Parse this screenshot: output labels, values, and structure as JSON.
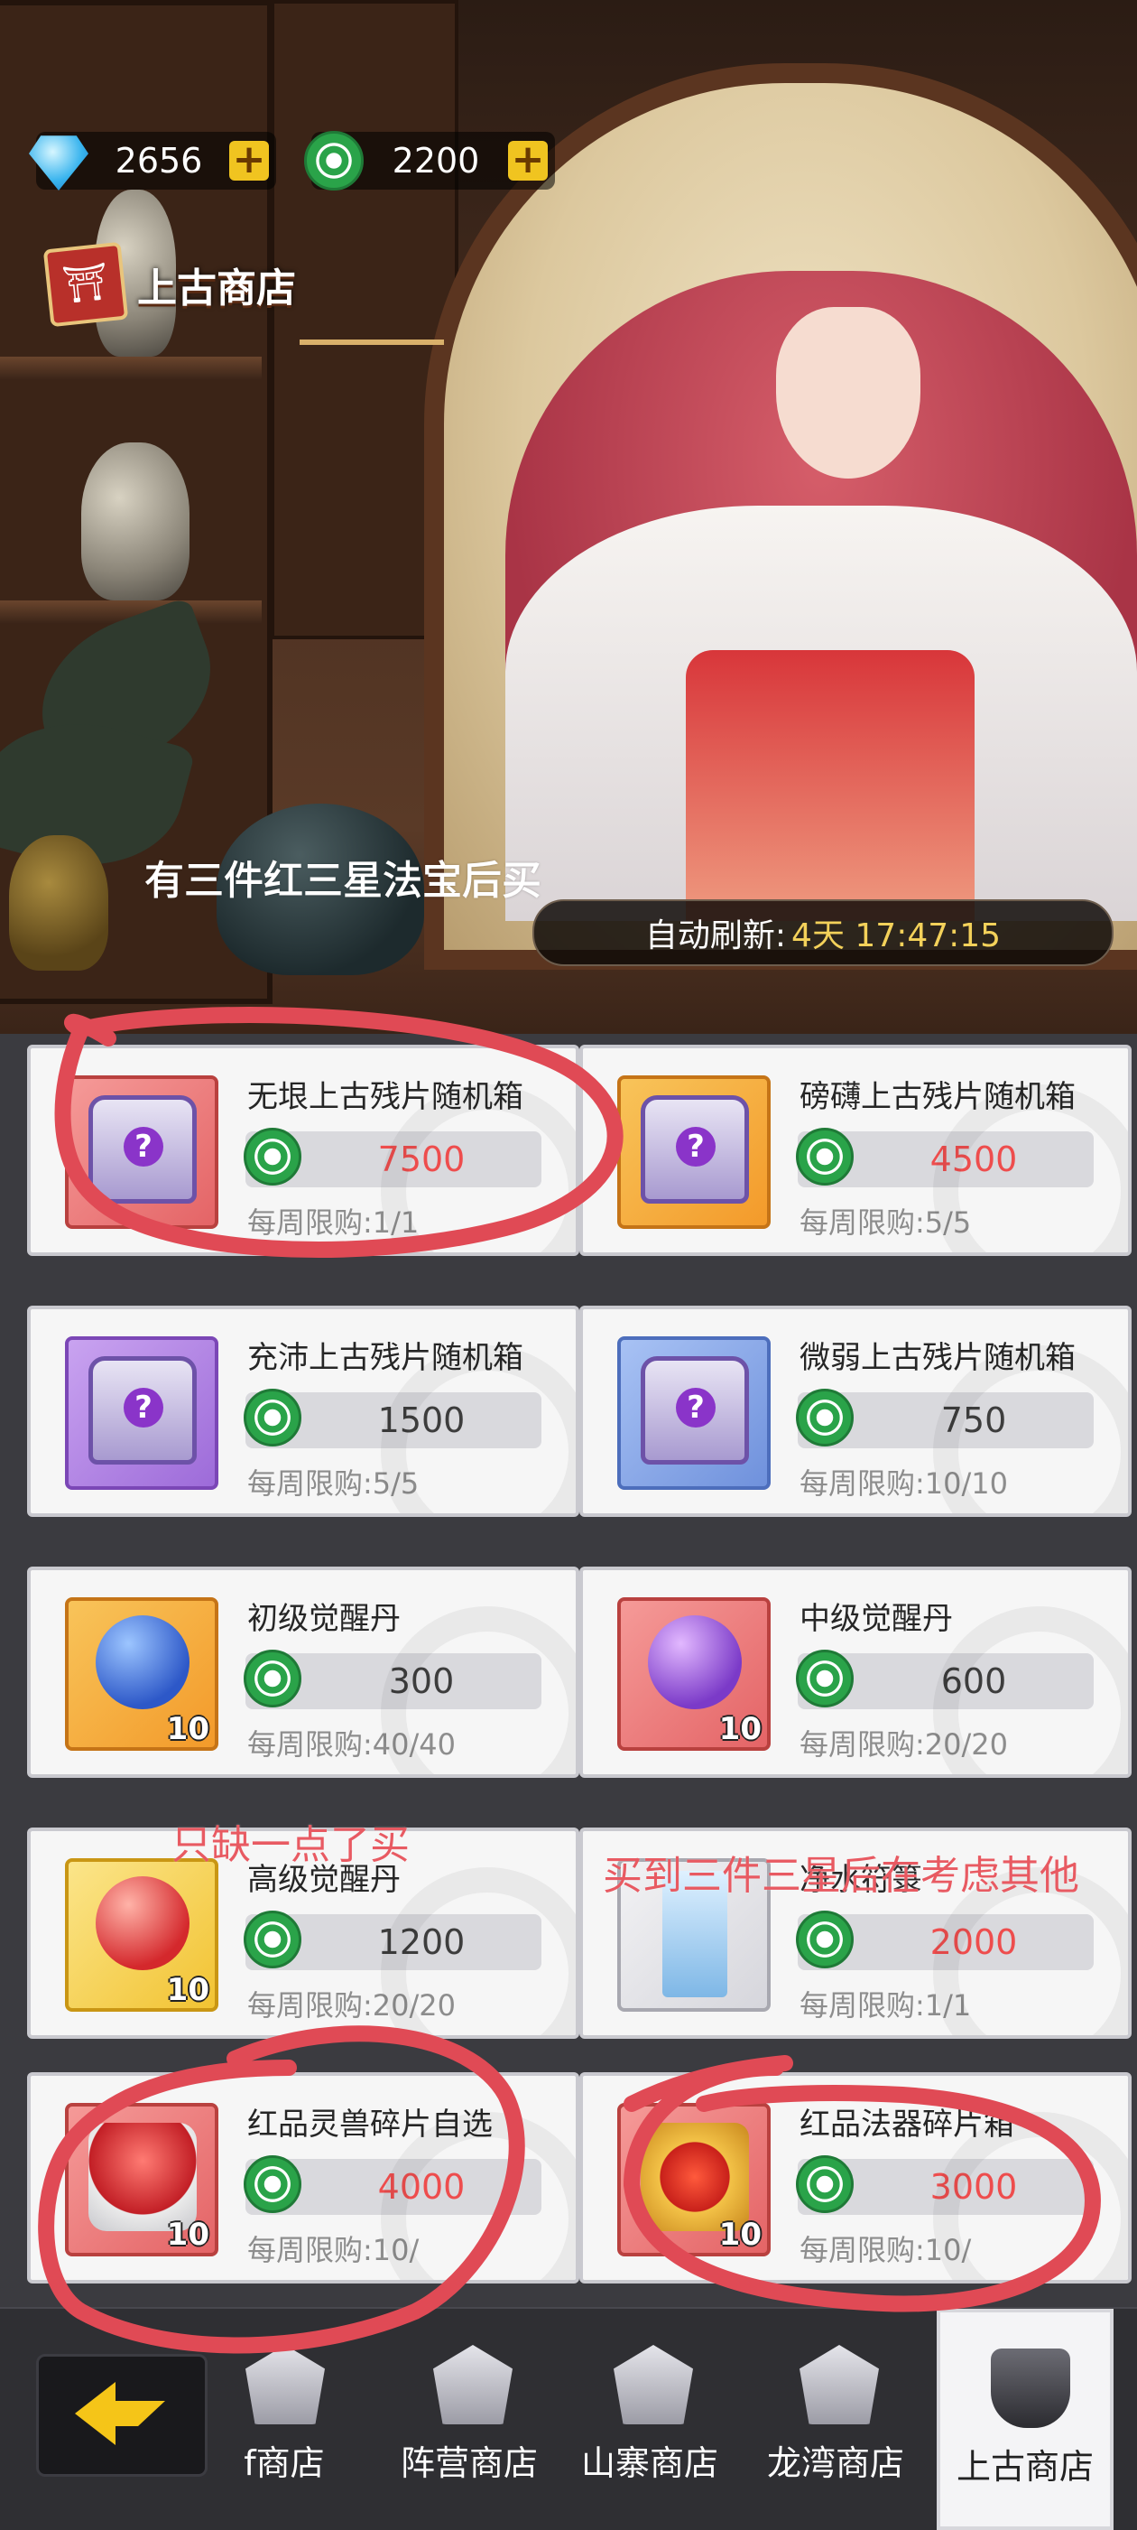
{
  "header": {
    "diamond_value": "2656",
    "jade_value": "2200",
    "plus_label": "+",
    "shop_title": "上古商店",
    "refresh_label": "自动刷新:",
    "refresh_time": "4天 17:47:15"
  },
  "annotations": {
    "top_note": "有三件红三星法宝后买",
    "mid_note": "只缺一点了买",
    "right_note": "买到三件三星后在考虑其他"
  },
  "items": [
    {
      "name": "无垠上古残片随机箱",
      "price": "7500",
      "price_red": true,
      "limit": "每周限购:1/1",
      "qty": ""
    },
    {
      "name": "磅礴上古残片随机箱",
      "price": "4500",
      "price_red": true,
      "limit": "每周限购:5/5",
      "qty": ""
    },
    {
      "name": "充沛上古残片随机箱",
      "price": "1500",
      "price_red": false,
      "limit": "每周限购:5/5",
      "qty": ""
    },
    {
      "name": "微弱上古残片随机箱",
      "price": "750",
      "price_red": false,
      "limit": "每周限购:10/10",
      "qty": ""
    },
    {
      "name": "初级觉醒丹",
      "price": "300",
      "price_red": false,
      "limit": "每周限购:40/40",
      "qty": "10"
    },
    {
      "name": "中级觉醒丹",
      "price": "600",
      "price_red": false,
      "limit": "每周限购:20/20",
      "qty": "10"
    },
    {
      "name": "高级觉醒丹",
      "price": "1200",
      "price_red": false,
      "limit": "每周限购:20/20",
      "qty": "10"
    },
    {
      "name": "净水符箓",
      "price": "2000",
      "price_red": true,
      "limit": "每周限购:1/1",
      "qty": ""
    },
    {
      "name": "红品灵兽碎片自选",
      "price": "4000",
      "price_red": true,
      "limit": "每周限购:10/",
      "qty": "10"
    },
    {
      "name": "红品法器碎片箱",
      "price": "3000",
      "price_red": true,
      "limit": "每周限购:10/",
      "qty": "10"
    }
  ],
  "nav": {
    "tabs": [
      {
        "label": "f商店"
      },
      {
        "label": "阵营商店"
      },
      {
        "label": "山寨商店"
      },
      {
        "label": "龙湾商店"
      },
      {
        "label": "上古商店"
      }
    ]
  },
  "colors": {
    "accent_gold": "#f3d15a",
    "price_red": "#ee4d4d",
    "annotation_red": "#e85a62"
  }
}
